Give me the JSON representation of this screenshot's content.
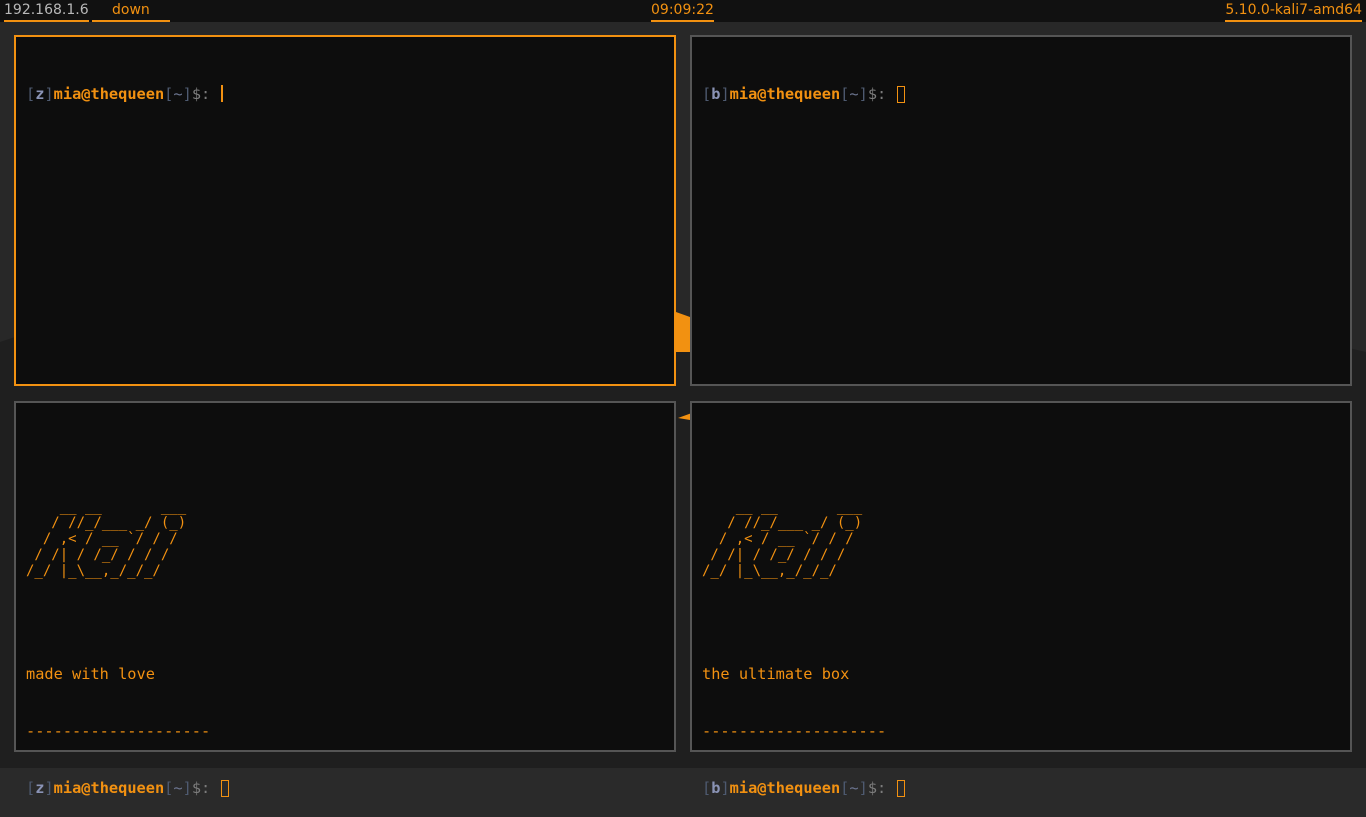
{
  "topbar": {
    "ip": "192.168.1.6",
    "network_status": "down",
    "clock": "09:09:22",
    "kernel": "5.10.0-kali7-amd64"
  },
  "prompt": {
    "user_host": "mia@thequeen",
    "dir": "~",
    "symbol": "$:"
  },
  "terminals": {
    "top_left": {
      "tag": "z"
    },
    "top_right": {
      "tag": "b"
    },
    "bottom_left": {
      "tag": "z",
      "banner": "    __ __       ___\n   / //_/___ _/ (_)\n  / ,< / __ `/ / /\n / /| / /_/ / / /\n/_/ |_\\__,_/_/_/",
      "message": "made with love",
      "divider": "--------------------"
    },
    "bottom_right": {
      "tag": "b",
      "banner": "    __ __       ___\n   / //_/___ _/ (_)\n  / ,< / __ `/ / /\n / /| / /_/ / / /\n/_/ |_\\__,_/_/_/",
      "message": "the ultimate box",
      "divider": "--------------------"
    }
  },
  "colors": {
    "accent": "#f29111",
    "terminal_bg": "#0d0d0d",
    "inactive_border": "#555555",
    "bar_bg": "#111111"
  }
}
